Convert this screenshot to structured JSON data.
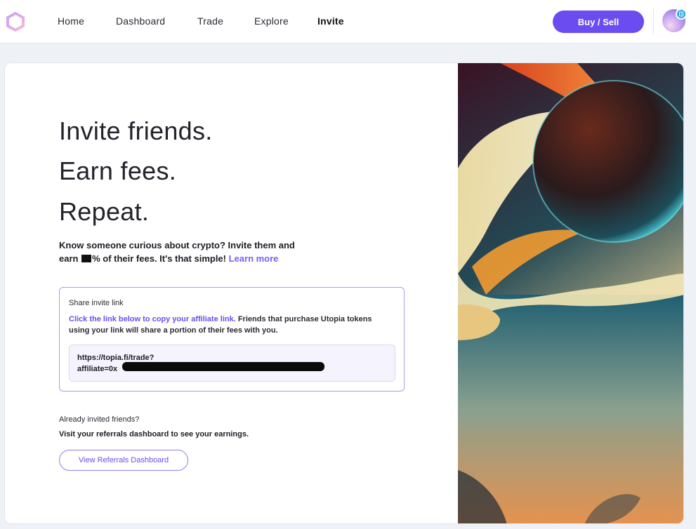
{
  "nav": {
    "links": [
      {
        "label": "Home"
      },
      {
        "label": "Dashboard"
      },
      {
        "label": "Trade"
      },
      {
        "label": "Explore"
      },
      {
        "label": "Invite"
      }
    ],
    "buy_sell_label": "Buy / Sell",
    "accent": "#6a4cf0"
  },
  "hero": {
    "line1": "Invite friends.",
    "line2": "Earn fees.",
    "line3": "Repeat.",
    "intro_part1": "Know someone curious about crypto? Invite them and earn ",
    "intro_part2": "% of their fees. It's that simple! ",
    "learn_more": "Learn more"
  },
  "share": {
    "title": "Share invite link",
    "desc_highlight": "Click the link below to copy your affiliate link.",
    "desc_rest": " Friends that purchase Utopia tokens using your link will share a portion of their fees with you.",
    "link_line1": "https://topia.fi/trade?",
    "link_line2": "affiliate=0x"
  },
  "referrals": {
    "already": "Already invited friends?",
    "visit": "Visit your referrals dashboard to see your earnings.",
    "button_label": "View Referrals Dashboard"
  },
  "icons": {
    "logo": "hexagon-logo-icon",
    "badge": "wallet-badge-icon"
  }
}
